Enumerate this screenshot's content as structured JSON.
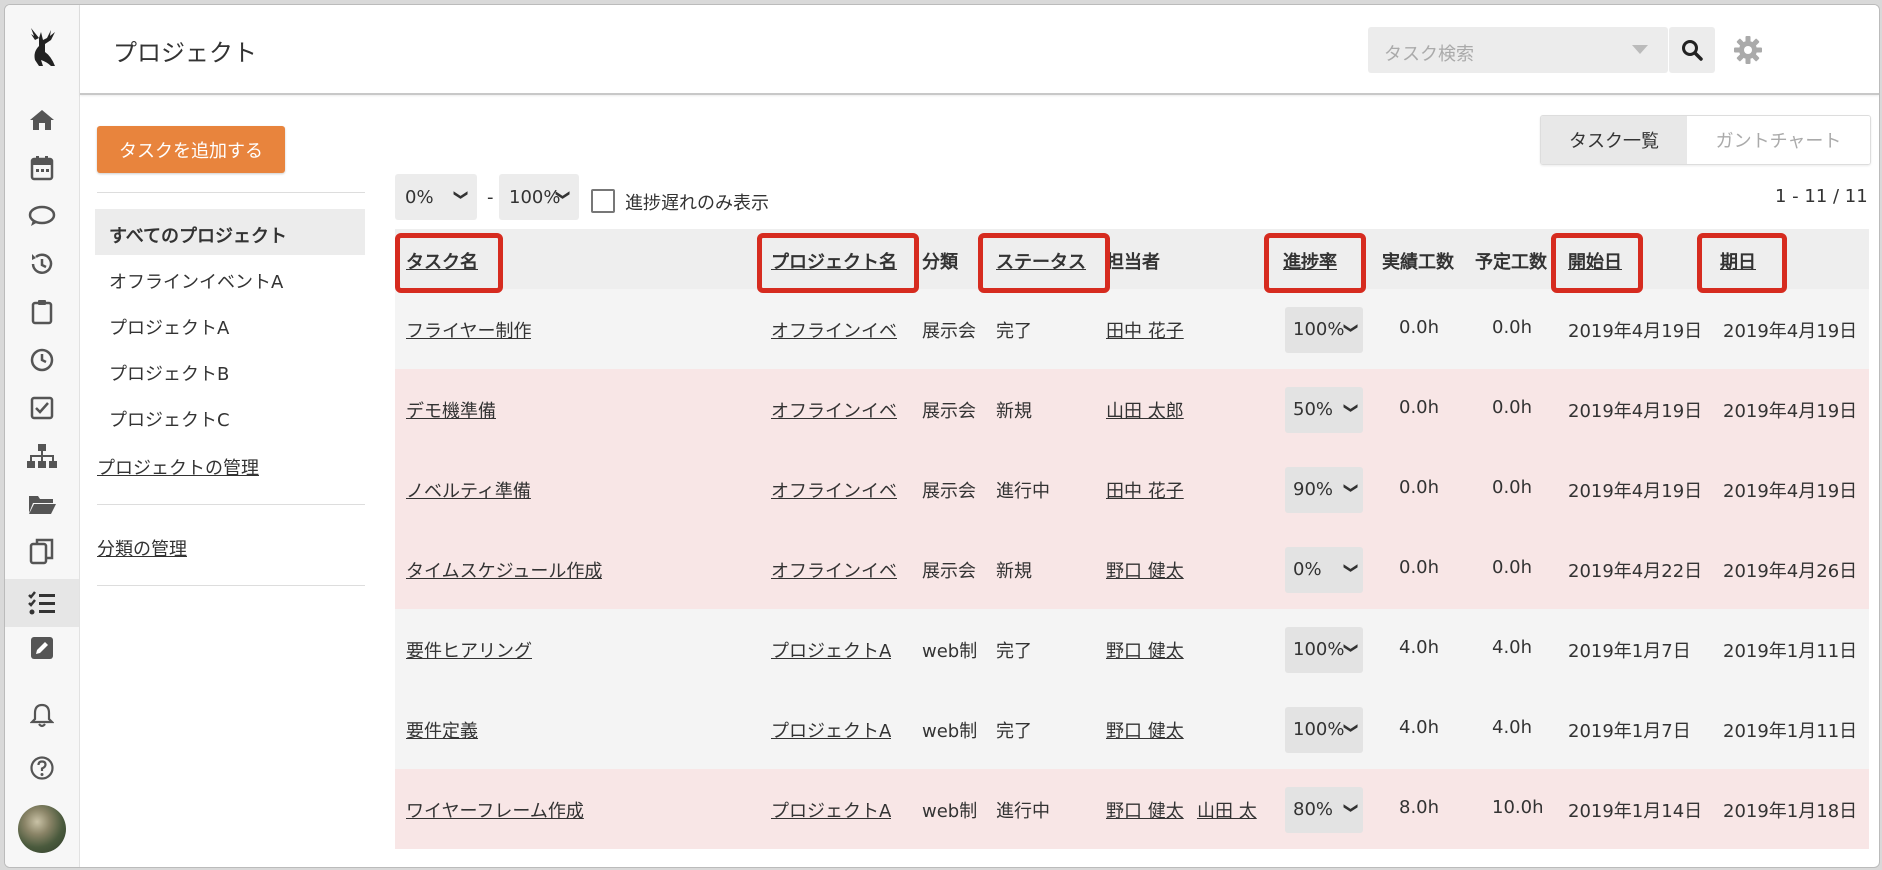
{
  "header": {
    "title": "プロジェクト",
    "search_placeholder": "タスク検索"
  },
  "sidebar": {
    "add_button": "タスクを追加する",
    "items": [
      "すべてのプロジェクト",
      "オフラインイベントA",
      "プロジェクトA",
      "プロジェクトB",
      "プロジェクトC"
    ],
    "manage_projects": "プロジェクトの管理",
    "manage_categories": "分類の管理"
  },
  "tabs": [
    "タスク一覧",
    "ガントチャート"
  ],
  "filters": {
    "from": "0%",
    "to": "100%",
    "delay_only_label": "進捗遅れのみ表示",
    "count": "1 - 11 / 11"
  },
  "table": {
    "headers": {
      "task": "タスク名",
      "project": "プロジェクト名",
      "category": "分類",
      "status": "ステータス",
      "assignee": "担当者",
      "progress": "進捗率",
      "actual": "実績工数",
      "planned": "予定工数",
      "start": "開始日",
      "due": "期日"
    },
    "rows": [
      {
        "task": "フライヤー制作",
        "project": "オフラインイベ",
        "category": "展示会",
        "status": "完了",
        "assignee": "田中 花子",
        "assignee2": "",
        "progress": "100%",
        "actual": "0.0h",
        "planned": "0.0h",
        "start": "2019年4月19日",
        "due": "2019年4月19日"
      },
      {
        "task": "デモ機準備",
        "project": "オフラインイベ",
        "category": "展示会",
        "status": "新規",
        "assignee": "山田 太郎",
        "assignee2": "",
        "progress": "50%",
        "actual": "0.0h",
        "planned": "0.0h",
        "start": "2019年4月19日",
        "due": "2019年4月19日"
      },
      {
        "task": "ノベルティ準備",
        "project": "オフラインイベ",
        "category": "展示会",
        "status": "進行中",
        "assignee": "田中 花子",
        "assignee2": "",
        "progress": "90%",
        "actual": "0.0h",
        "planned": "0.0h",
        "start": "2019年4月19日",
        "due": "2019年4月19日"
      },
      {
        "task": "タイムスケジュール作成",
        "project": "オフラインイベ",
        "category": "展示会",
        "status": "新規",
        "assignee": "野口 健太",
        "assignee2": "",
        "progress": "0%",
        "actual": "0.0h",
        "planned": "0.0h",
        "start": "2019年4月22日",
        "due": "2019年4月26日"
      },
      {
        "task": "要件ヒアリング",
        "project": "プロジェクトA",
        "category": "web制",
        "status": "完了",
        "assignee": "野口 健太",
        "assignee2": "",
        "progress": "100%",
        "actual": "4.0h",
        "planned": "4.0h",
        "start": "2019年1月7日",
        "due": "2019年1月11日"
      },
      {
        "task": "要件定義",
        "project": "プロジェクトA",
        "category": "web制",
        "status": "完了",
        "assignee": "野口 健太",
        "assignee2": "",
        "progress": "100%",
        "actual": "4.0h",
        "planned": "4.0h",
        "start": "2019年1月7日",
        "due": "2019年1月11日"
      },
      {
        "task": "ワイヤーフレーム作成",
        "project": "プロジェクトA",
        "category": "web制",
        "status": "進行中",
        "assignee": "野口 健太",
        "assignee2": "山田 太",
        "progress": "80%",
        "actual": "8.0h",
        "planned": "10.0h",
        "start": "2019年1月14日",
        "due": "2019年1月18日"
      }
    ]
  },
  "colors": {
    "accent": "#e8843d",
    "highlight": "#d62b1f",
    "row_delay": "#f8e6e6",
    "row_normal": "#f4f4f4"
  }
}
